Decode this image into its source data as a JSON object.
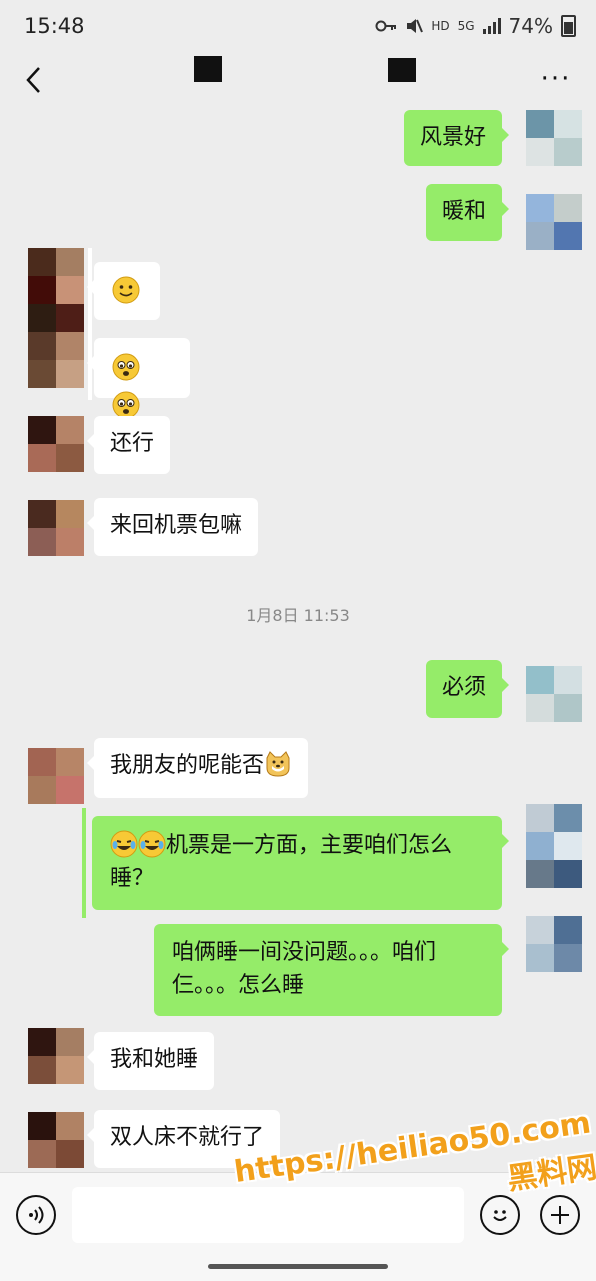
{
  "status_bar": {
    "time": "15:48",
    "hd_label": "HD",
    "network_label": "5G",
    "battery_percent": "74%"
  },
  "header": {
    "back_icon": "chevron-left-icon",
    "more_label": "···"
  },
  "messages": [
    {
      "side": "right",
      "text": "风景好"
    },
    {
      "side": "right",
      "text": "暖和"
    },
    {
      "side": "left",
      "emoji": "smile",
      "count": 1
    },
    {
      "side": "left",
      "emoji": "pleading",
      "count": 2
    },
    {
      "side": "left",
      "text": "还行"
    },
    {
      "side": "left",
      "text": "来回机票包嘛"
    },
    {
      "side": "right",
      "text": "必须"
    },
    {
      "side": "left",
      "text": "我朋友的呢能否",
      "trailing_emoji": "doge"
    },
    {
      "side": "right",
      "text": "机票是一方面，主要咱们怎么睡？",
      "leading_emoji": "laugh-cry",
      "leading_emoji_count": 2
    },
    {
      "side": "right",
      "text": "咱俩睡一间没问题。。。咱们仨。。。怎么睡"
    },
    {
      "side": "left",
      "text": "我和她睡"
    },
    {
      "side": "left",
      "text": "双人床不就行了"
    }
  ],
  "timestamp": "1月8日 11:53",
  "input_bar": {
    "voice_icon": "voice-icon",
    "emoji_icon": "emoji-icon",
    "plus_icon": "plus-icon",
    "input_value": ""
  },
  "watermark": {
    "line1": "https://heiliao50.com",
    "line2": "黑料网"
  },
  "colors": {
    "background": "#ededed",
    "bubble_right": "#95ec69",
    "bubble_left": "#ffffff",
    "watermark": "#f2a01b"
  }
}
